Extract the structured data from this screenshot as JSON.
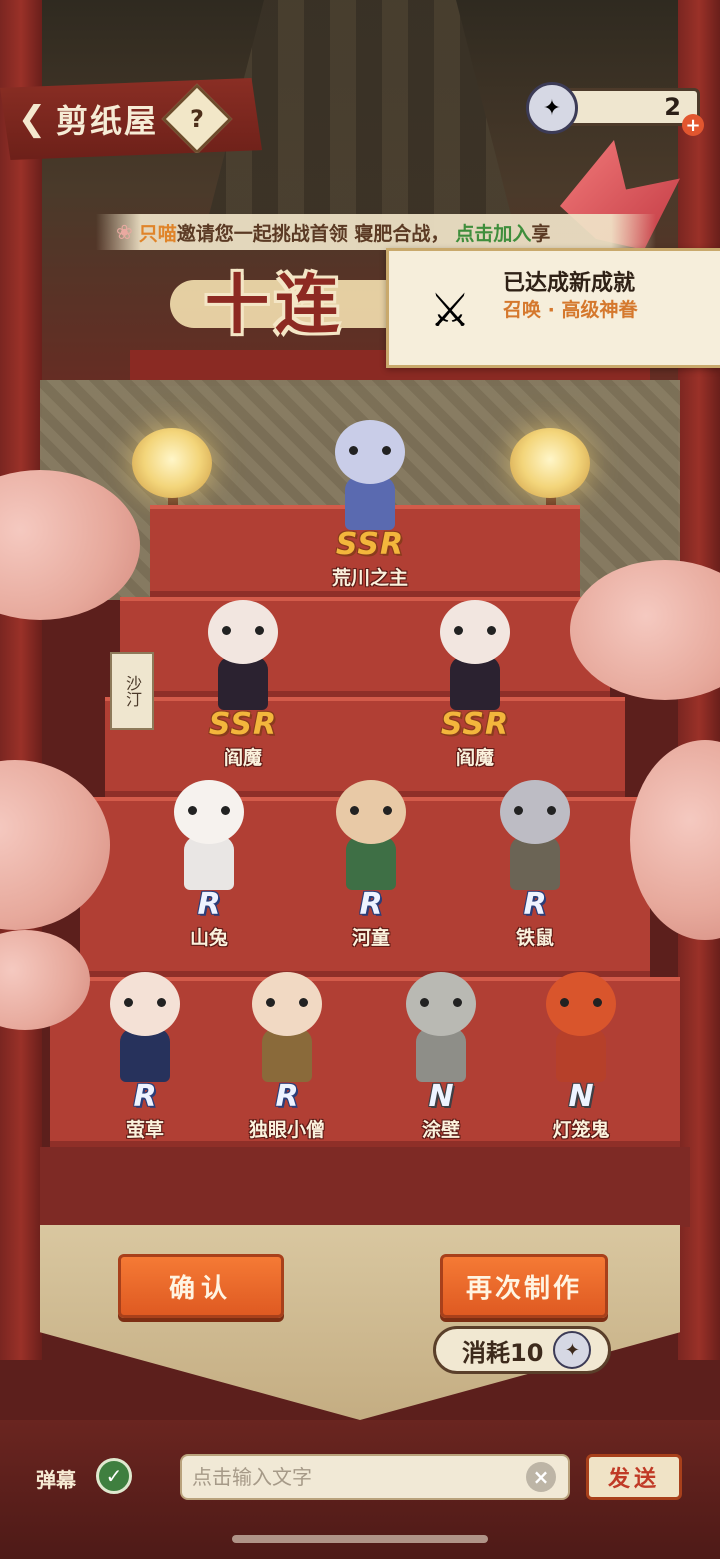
{
  "header": {
    "title": "剪纸屋",
    "help_label": "?",
    "currency_count": "2",
    "currency_plus": "+"
  },
  "invite": {
    "name": "只喵",
    "middle": "邀请您一起挑战首领 寝肥合战，",
    "link": "点击加入",
    "tail": "享"
  },
  "tenpull": {
    "title": "十连"
  },
  "achievement": {
    "title": "已达成新成就",
    "subtitle": "召唤 · 高级神眷"
  },
  "side_tag": "沙汀",
  "characters": [
    {
      "name": "荒川之主",
      "rarity": "SSR",
      "colors": {
        "head": "#c9cde8",
        "body": "#5a6ab0"
      }
    },
    {
      "name": "阎魔",
      "rarity": "SSR",
      "colors": {
        "head": "#f2e6e0",
        "body": "#2b2230"
      }
    },
    {
      "name": "阎魔",
      "rarity": "SSR",
      "colors": {
        "head": "#f2e6e0",
        "body": "#2b2230"
      }
    },
    {
      "name": "山兔",
      "rarity": "R",
      "colors": {
        "head": "#f6f2ee",
        "body": "#e9e6e4"
      }
    },
    {
      "name": "河童",
      "rarity": "R",
      "colors": {
        "head": "#e8c9a6",
        "body": "#3e6f45"
      }
    },
    {
      "name": "铁鼠",
      "rarity": "R",
      "colors": {
        "head": "#bdbcc4",
        "body": "#6b6455"
      }
    },
    {
      "name": "萤草",
      "rarity": "R",
      "colors": {
        "head": "#f4e1d6",
        "body": "#27325c"
      }
    },
    {
      "name": "独眼小僧",
      "rarity": "R",
      "colors": {
        "head": "#f1d9c3",
        "body": "#8a6a3a"
      }
    },
    {
      "name": "涂壁",
      "rarity": "N",
      "colors": {
        "head": "#b9b9b3",
        "body": "#8e8e88"
      }
    },
    {
      "name": "灯笼鬼",
      "rarity": "N",
      "colors": {
        "head": "#d9552c",
        "body": "#b6402a"
      }
    }
  ],
  "actions": {
    "confirm_label": "确认",
    "retry_label": "再次制作",
    "cost_label": "消耗10"
  },
  "bottom": {
    "danmu_label": "弹幕",
    "input_placeholder": "点击输入文字",
    "input_value": "",
    "clear_label": "×",
    "send_label": "发送"
  },
  "colors": {
    "accent_orange": "#df5a22",
    "stair_red": "#b13f34",
    "ssr_gold": "#f3b63c",
    "r_blue": "#2b3e79"
  },
  "icons": {
    "back": "chevron-left-icon",
    "help": "question-icon",
    "currency": "paper-doll-icon",
    "achievement": "crossed-swords-icon",
    "danmu_toggle": "check-icon",
    "clear": "close-icon"
  }
}
